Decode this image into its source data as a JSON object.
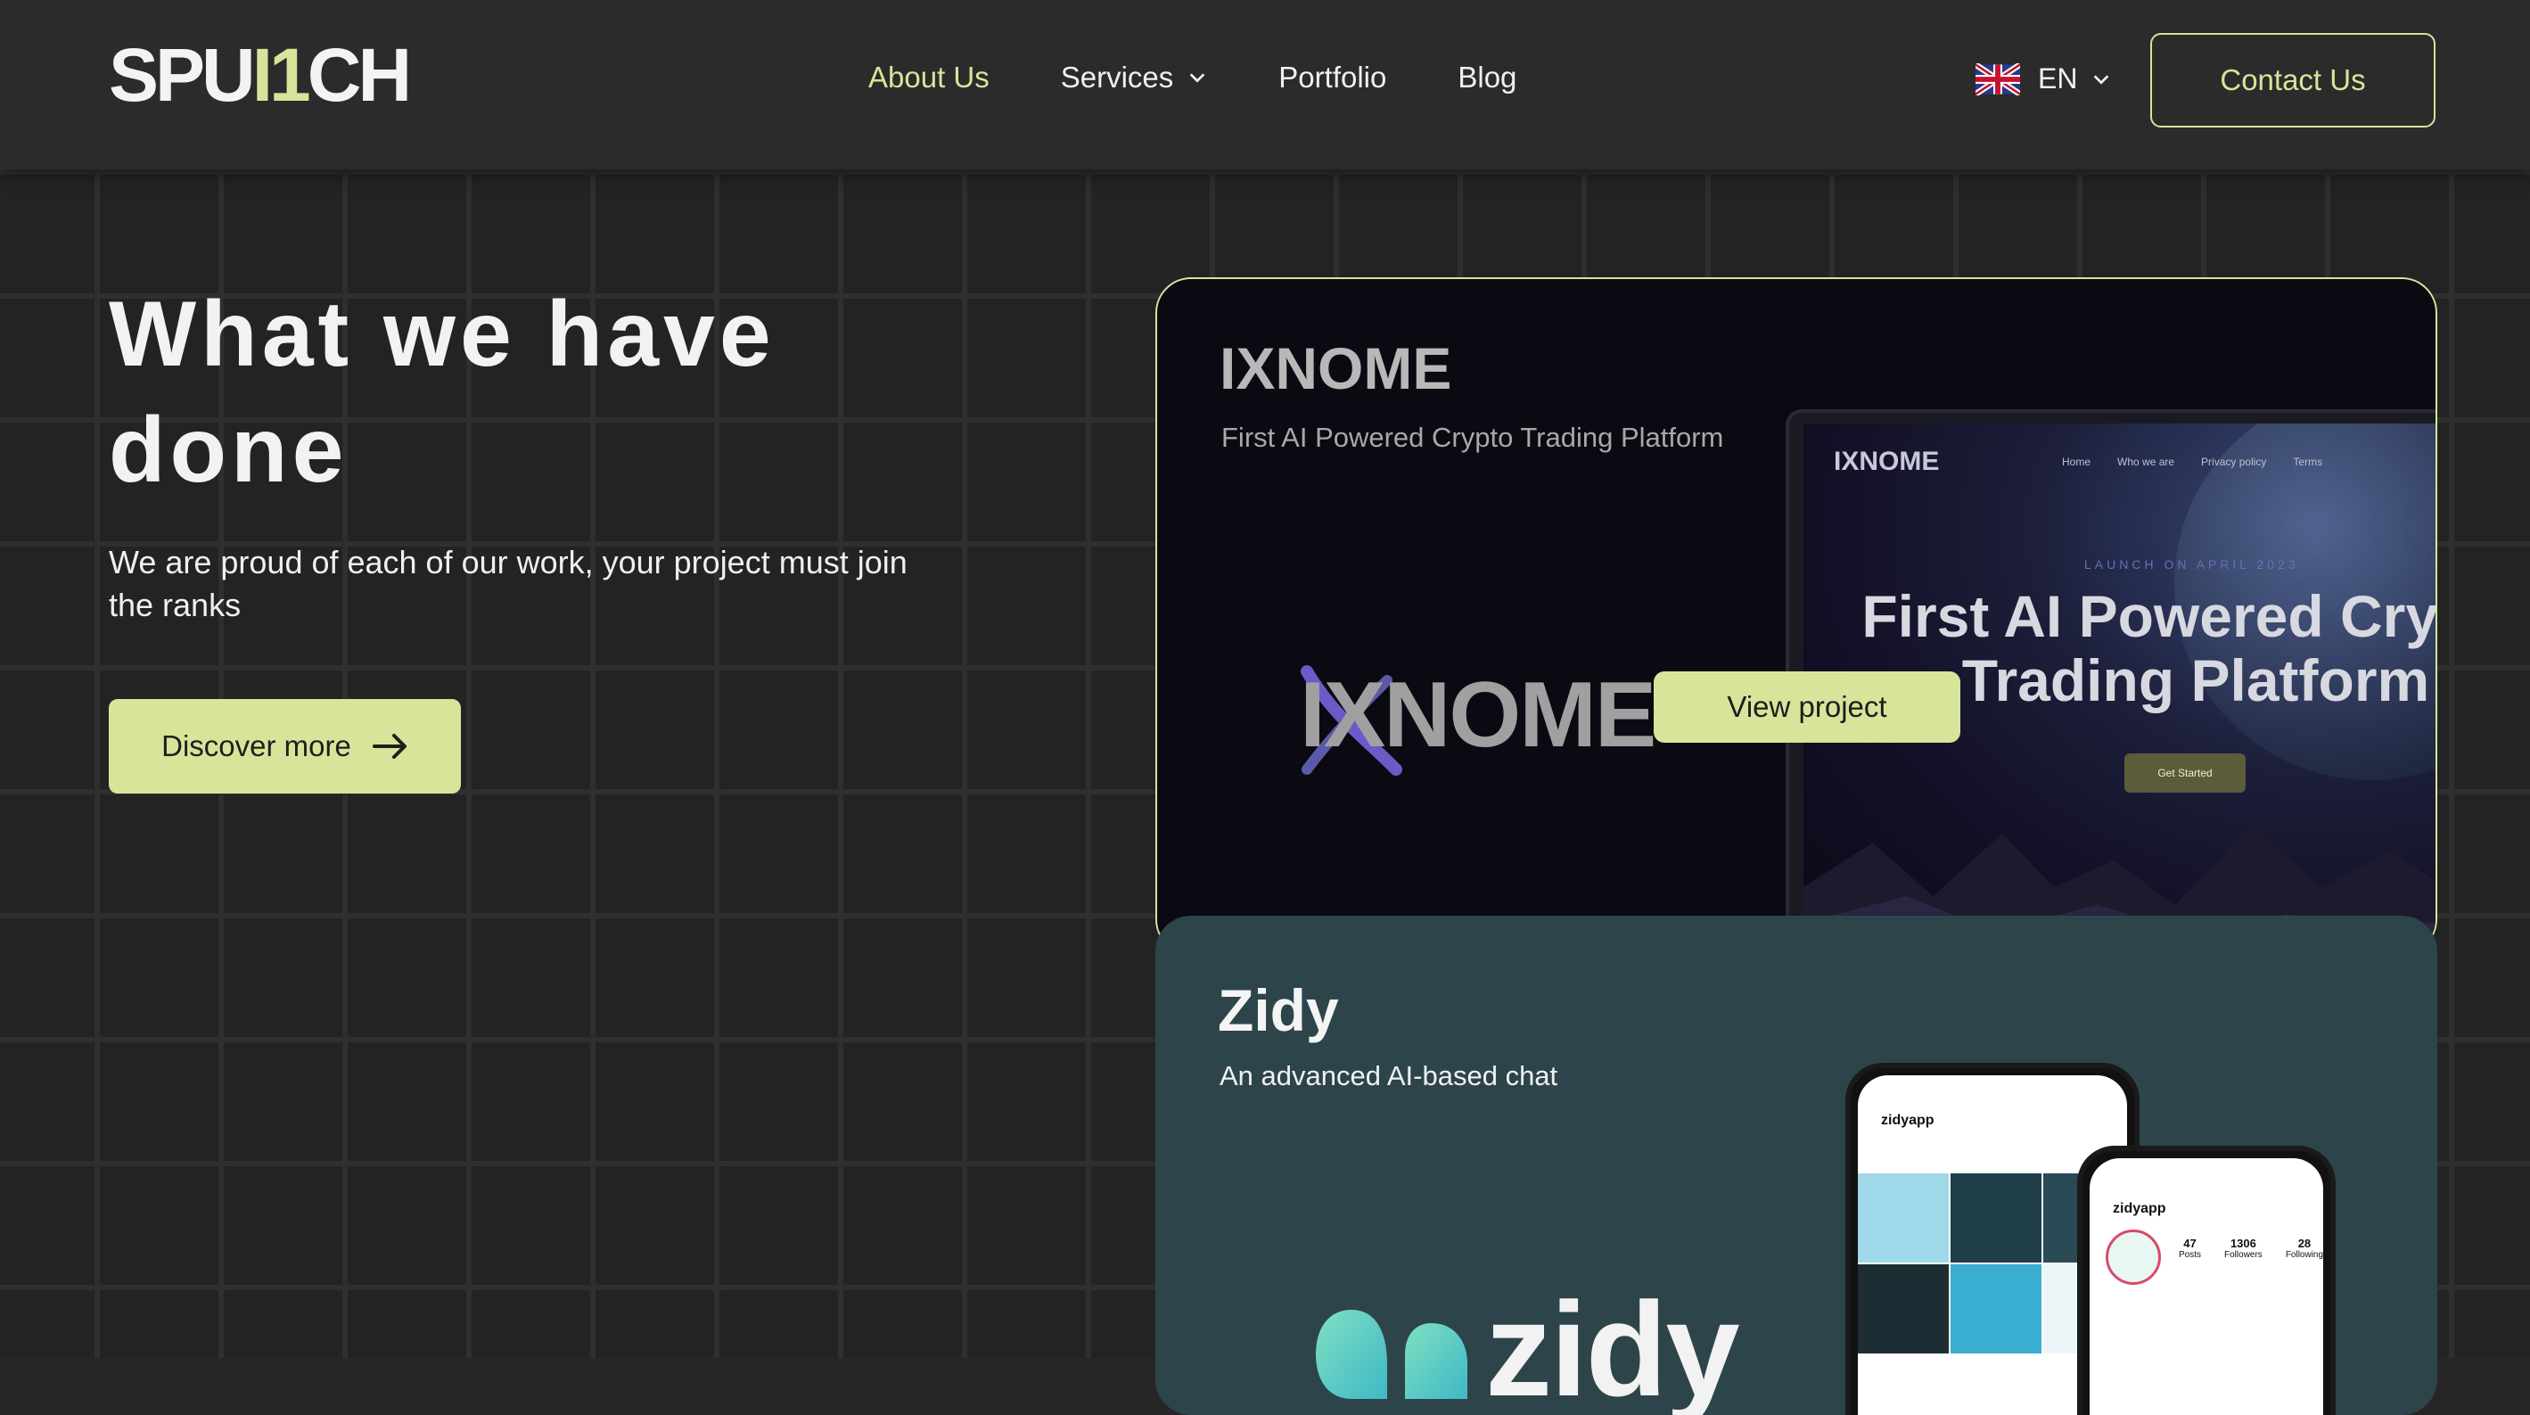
{
  "header": {
    "logo": {
      "part1": "SPU",
      "part2": "I1",
      "part3": "CH"
    },
    "nav": [
      {
        "label": "About Us",
        "active": true
      },
      {
        "label": "Services",
        "dropdown": true
      },
      {
        "label": "Portfolio"
      },
      {
        "label": "Blog"
      }
    ],
    "language": "EN",
    "contact_label": "Contact Us"
  },
  "hero": {
    "title": "What we have done",
    "subtitle": "We are proud of each of our work, your project must join the ranks",
    "cta_label": "Discover more"
  },
  "projects": [
    {
      "name": "IXNOME",
      "tagline": "First AI Powered Crypto Trading Platform",
      "logo_text": "IXNOME",
      "view_label": "View project",
      "preview": {
        "logo": "IXNOME",
        "nav": [
          "Home",
          "Who we are",
          "Privacy policy",
          "Terms"
        ],
        "launch": "LAUNCH ON APRIL 2023",
        "headline": "First AI Powered Crypto Trading Platform",
        "button": "Get Started"
      }
    },
    {
      "name": "Zidy",
      "tagline": "An advanced AI-based chat",
      "logo_text": "zidy",
      "preview": {
        "handle": "zidyapp",
        "posts": "47",
        "followers": "1306",
        "following": "28",
        "posts_label": "Posts",
        "followers_label": "Followers",
        "following_label": "Following"
      }
    }
  ],
  "colors": {
    "accent": "#d6e59a",
    "background": "#262626",
    "card1": "#0b0912",
    "card2": "#2d454a"
  }
}
